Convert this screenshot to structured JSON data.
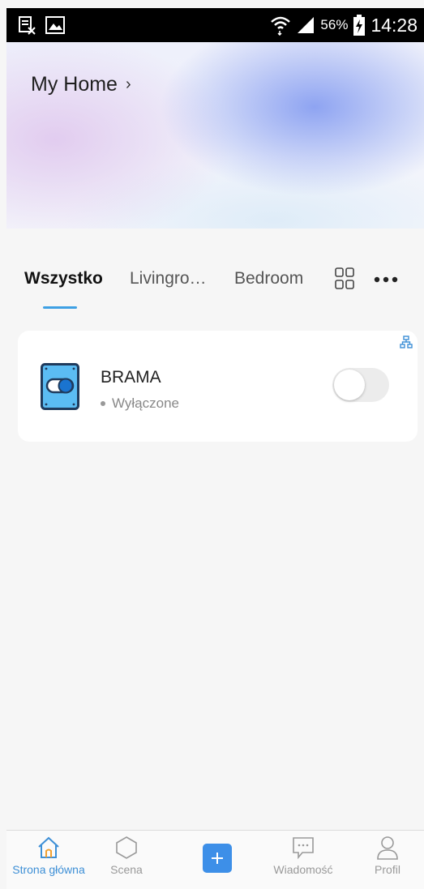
{
  "status_bar": {
    "battery_percent": "56%",
    "time": "14:28",
    "icons": [
      "notes-off-icon",
      "image-icon",
      "wifi-icon",
      "signal-icon",
      "battery-charging-icon"
    ]
  },
  "header": {
    "home_name": "My Home",
    "chevron": "›"
  },
  "tabs": {
    "items": [
      {
        "label": "Wszystko",
        "active": true
      },
      {
        "label": "Livingro…",
        "active": false
      },
      {
        "label": "Bedroom",
        "active": false
      }
    ],
    "accent_color": "#3ea0e4"
  },
  "device": {
    "name": "BRAMA",
    "status": "Wyłączone",
    "toggle_on": false,
    "icon": "switch-device-icon"
  },
  "bottom_nav": {
    "items": [
      {
        "label": "Strona główna",
        "icon": "home-icon",
        "active": true
      },
      {
        "label": "Scena",
        "icon": "hexagon-icon",
        "active": false
      },
      {
        "label": "",
        "icon": "add-icon",
        "active": false
      },
      {
        "label": "Wiadomość",
        "icon": "message-icon",
        "active": false
      },
      {
        "label": "Profil",
        "icon": "profile-icon",
        "active": false
      }
    ],
    "active_color": "#3d8fd6"
  }
}
